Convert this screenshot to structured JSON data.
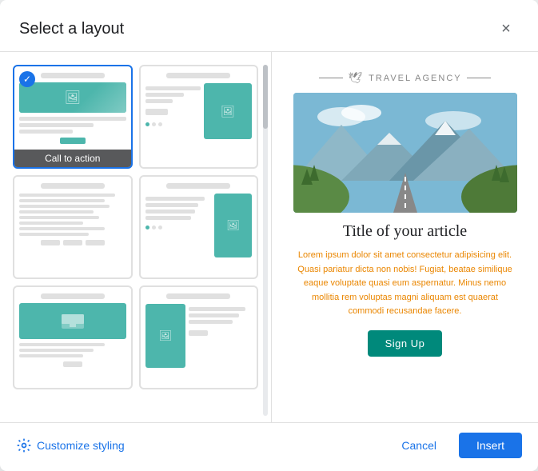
{
  "dialog": {
    "title": "Select a layout",
    "close_label": "×"
  },
  "layouts": [
    {
      "id": "layout-1",
      "label": "Call to action",
      "selected": true
    },
    {
      "id": "layout-2",
      "label": "",
      "selected": false
    },
    {
      "id": "layout-3",
      "label": "",
      "selected": false
    },
    {
      "id": "layout-4",
      "label": "",
      "selected": false
    },
    {
      "id": "layout-5",
      "label": "",
      "selected": false
    },
    {
      "id": "layout-6",
      "label": "",
      "selected": false
    }
  ],
  "preview": {
    "brand": "TRAVEL  AGENCY",
    "title": "Title of your article",
    "body": "Lorem ipsum dolor sit amet consectetur adipisicing elit. Quasi pariatur dicta non nobis! Fugiat, beatae similique eaque voluptate quasi eum aspernatur. Minus nemo mollitia rem voluptas magni aliquam est quaerat commodi recusandae facere.",
    "cta_label": "Sign Up"
  },
  "footer": {
    "customize_label": "Customize styling",
    "cancel_label": "Cancel",
    "insert_label": "Insert"
  }
}
